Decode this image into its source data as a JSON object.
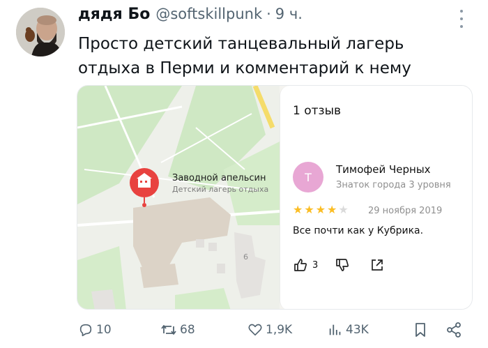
{
  "author": {
    "name": "дядя Бо",
    "handle": "@softskillpunk",
    "separator": "·",
    "time": "9 ч."
  },
  "tweet": {
    "text": "Просто детский танцевальный лагерь отдыха в Перми и комментарий к нему"
  },
  "card": {
    "map": {
      "poi_title": "Заводной апельсин",
      "poi_subtitle": "Детский лагерь отдыха",
      "house_number": "6",
      "pin_color": "#e8423f"
    },
    "reviews": {
      "title": "1 отзыв",
      "review": {
        "avatar_letter": "Т",
        "avatar_color": "#e8a7d4",
        "author": "Тимофей Черных",
        "level": "Знаток города 3 уровня",
        "rating": 4,
        "rating_max": 5,
        "star_on": "★",
        "star_off": "★",
        "date": "29 ноября 2019",
        "text": "Все почти как у Кубрика.",
        "likes": "3"
      }
    }
  },
  "actions": {
    "replies": "10",
    "reposts": "68",
    "likes": "1,9K",
    "views": "43K"
  },
  "icons": [
    "more-icon",
    "like-hand-icon",
    "dislike-hand-icon",
    "share-arrow-icon",
    "reply-icon",
    "repost-icon",
    "heart-icon",
    "views-icon",
    "bookmark-icon",
    "share-icon",
    "poi-pin-icon"
  ]
}
